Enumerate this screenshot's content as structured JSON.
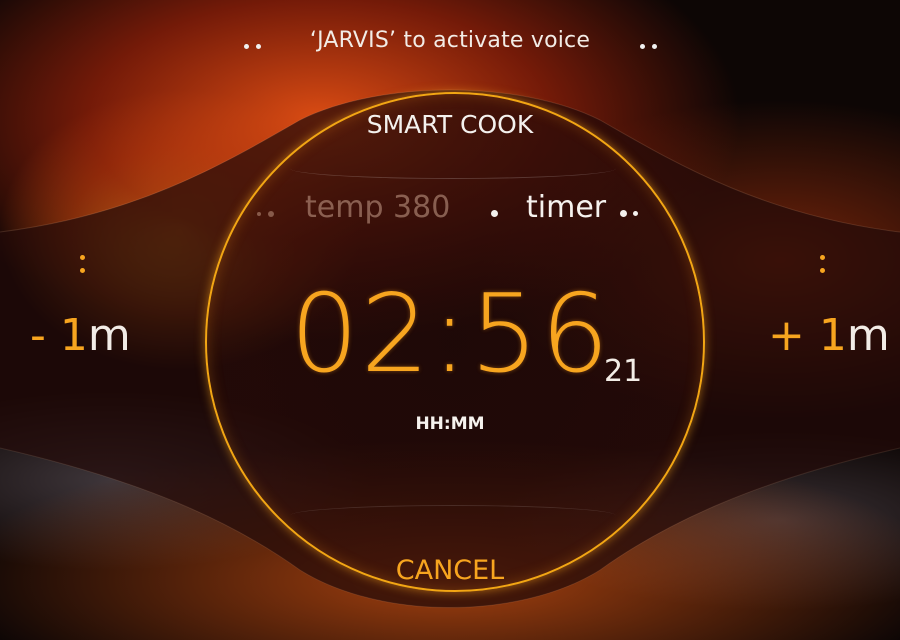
{
  "voice": {
    "hint": "‘JARVIS’ to activate voice"
  },
  "header": {
    "title": "SMART COOK"
  },
  "modes": {
    "temp_label": "temp 380",
    "timer_label": "timer"
  },
  "timer": {
    "main": "02:56",
    "seconds": "21",
    "format_label": "HH:MM"
  },
  "adjust": {
    "minus": {
      "sign": "- ",
      "amount": "1",
      "unit": "m"
    },
    "plus": {
      "sign": "+ ",
      "amount": "1",
      "unit": "m"
    }
  },
  "actions": {
    "cancel_label": "CANCEL"
  },
  "colors": {
    "accent": "#f7a51f",
    "text": "#f4f1ee",
    "muted": "#c8a08c"
  }
}
